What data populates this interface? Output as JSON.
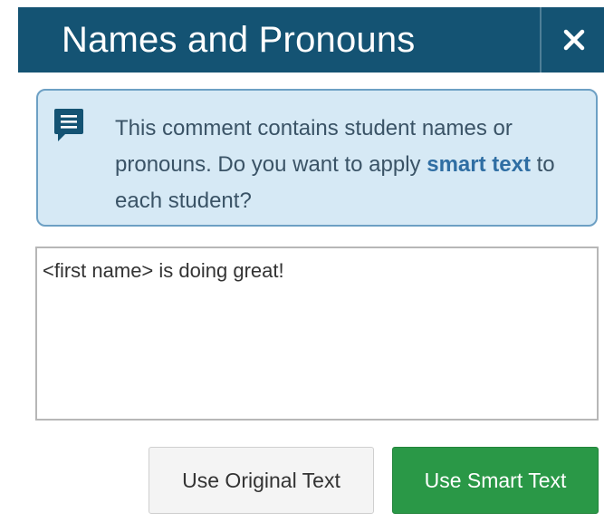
{
  "dialog": {
    "title": "Names and Pronouns",
    "close_icon": "close-icon",
    "close_glyph": "✕"
  },
  "info": {
    "icon": "comment-icon",
    "text_before": "This comment contains student names or pronouns. Do you want to apply ",
    "highlight": "smart text",
    "text_after": " to each student?"
  },
  "comment": {
    "value": "<first name> is doing great!"
  },
  "buttons": {
    "original_label": "Use Original Text",
    "smart_label": "Use Smart Text"
  },
  "colors": {
    "header_bg": "#145373",
    "info_bg": "#d6e9f5",
    "info_border": "#6da0c4",
    "smart_text": "#2f6ea3",
    "primary_button": "#2a9847"
  }
}
